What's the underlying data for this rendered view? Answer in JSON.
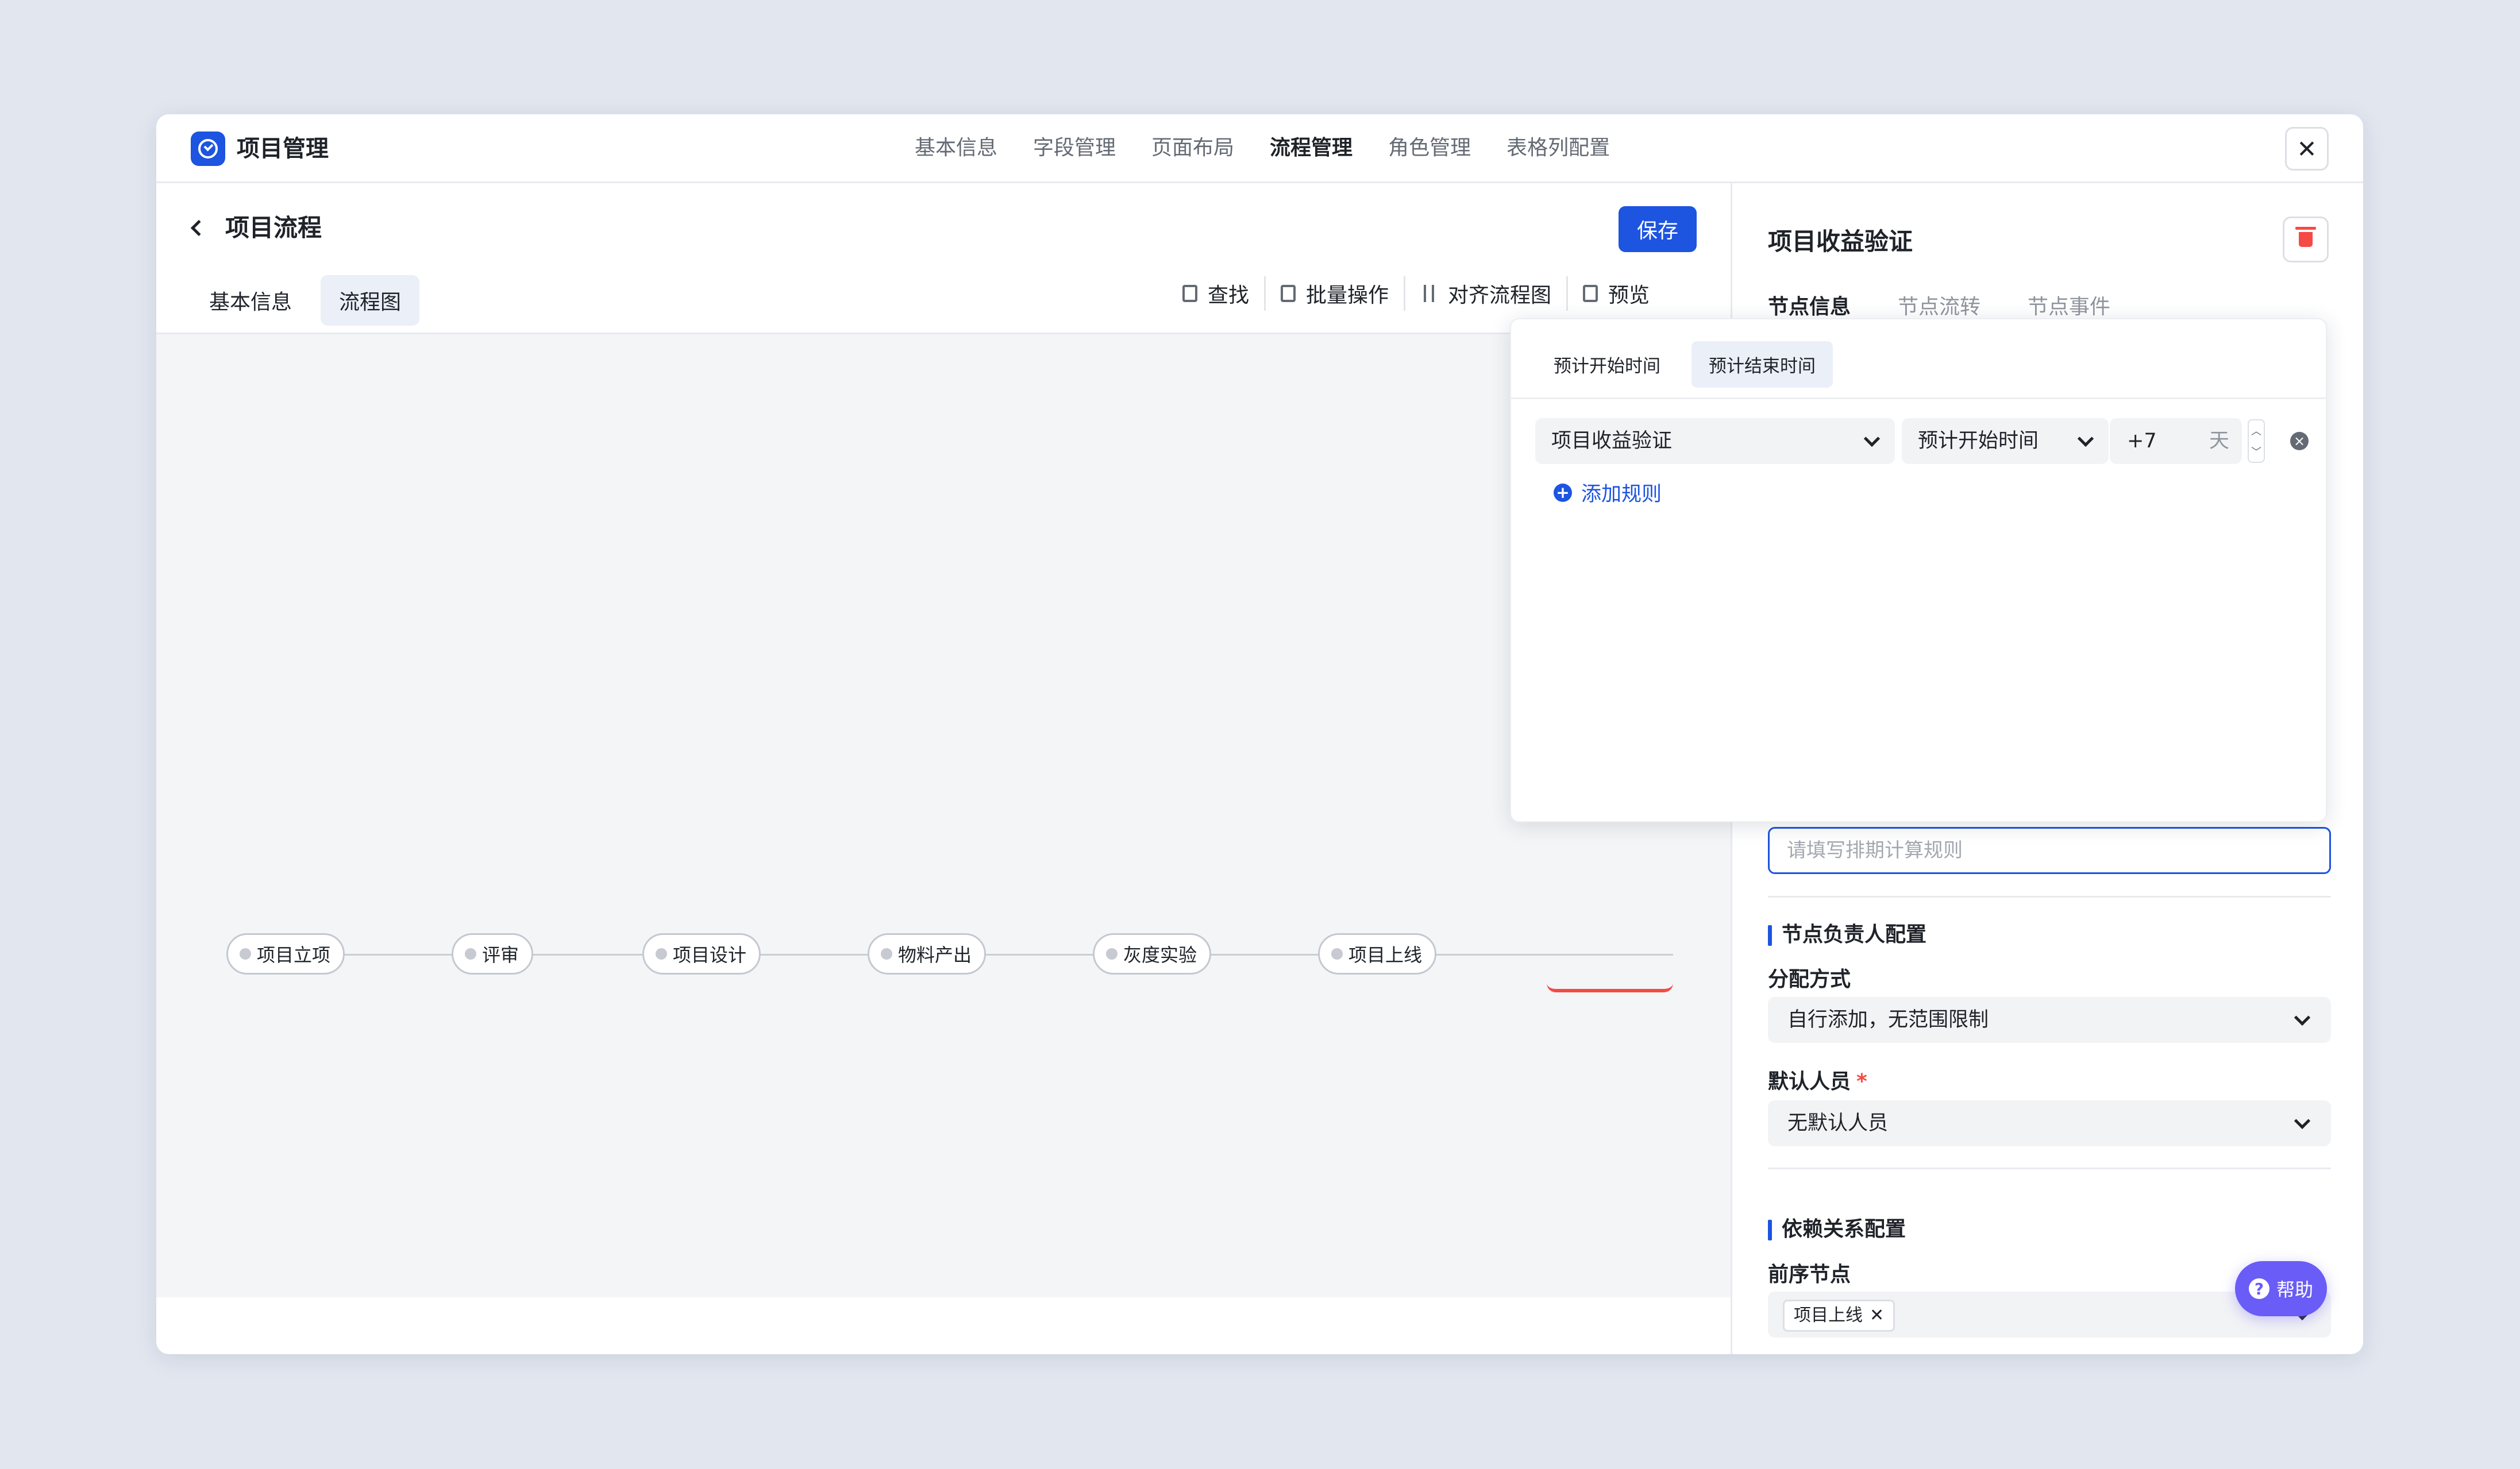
{
  "app": {
    "title": "项目管理"
  },
  "topnav": {
    "items": [
      "基本信息",
      "字段管理",
      "页面布局",
      "流程管理",
      "角色管理",
      "表格列配置"
    ],
    "active": "流程管理"
  },
  "left": {
    "title": "项目流程",
    "save_label": "保存",
    "tabs": [
      "基本信息",
      "流程图"
    ],
    "active_tab": "流程图",
    "toolbar": {
      "find": "查找",
      "batch": "批量操作",
      "align": "对齐流程图",
      "preview": "预览"
    },
    "nodes": [
      "项目立项",
      "评审",
      "项目设计",
      "物料产出",
      "灰度实验",
      "项目上线"
    ]
  },
  "right": {
    "node_title": "项目收益验证",
    "tabs": [
      "节点信息",
      "节点流转",
      "节点事件"
    ],
    "active_tab": "节点信息",
    "rule_placeholder": "请填写排期计算规则",
    "owner_section": "节点负责人配置",
    "assign_label": "分配方式",
    "assign_value": "自行添加，无范围限制",
    "default_label": "默认人员",
    "default_required": "*",
    "default_value": "无默认人员",
    "dep_section": "依赖关系配置",
    "prev_label": "前序节点",
    "prev_tag": "项目上线"
  },
  "popover": {
    "tabs": [
      "预计开始时间",
      "预计结束时间"
    ],
    "active_tab": "预计结束时间",
    "rule": {
      "node": "项目收益验证",
      "field": "预计开始时间",
      "offset": "+7",
      "unit": "天"
    },
    "add_rule": "添加规则"
  },
  "help": {
    "label": "帮助"
  },
  "colors": {
    "accent": "#1d54e0",
    "danger": "#f54a45",
    "help": "#6a5cf6"
  }
}
